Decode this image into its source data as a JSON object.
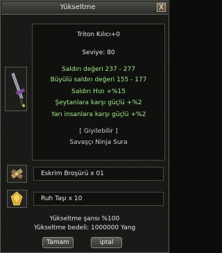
{
  "window": {
    "title": "Yükseltme",
    "close_label": "X"
  },
  "item": {
    "name": "Triton Kılıcı+0",
    "level": "Seviye: 80",
    "stats": [
      "Saldırı değeri 237 - 277",
      "Büyülü saldırı değeri 155 - 177",
      "Saldırı Hızı +%15",
      "Şeytanlara karşı güçlü +%2",
      "Yarı insanlara karşı güçlü +%2"
    ],
    "wearable": "[ Giyilebilir ]",
    "classes": "Savaşçı Ninja Sura",
    "icon": "sword-icon"
  },
  "materials": [
    {
      "label": "Eskrim Broşürü x 01",
      "icon": "scroll-icon"
    },
    {
      "label": "Ruh Taşı x 10",
      "icon": "soul-stone-icon"
    }
  ],
  "upgrade": {
    "chance": "Yükseltme şansı %100",
    "cost": "Yükseltme bedeli: 1000000 Yang"
  },
  "buttons": {
    "ok": "Tamam",
    "cancel": "iptal"
  },
  "colors": {
    "stat_text": "#a4e88e",
    "frame": "#5d5f57"
  }
}
